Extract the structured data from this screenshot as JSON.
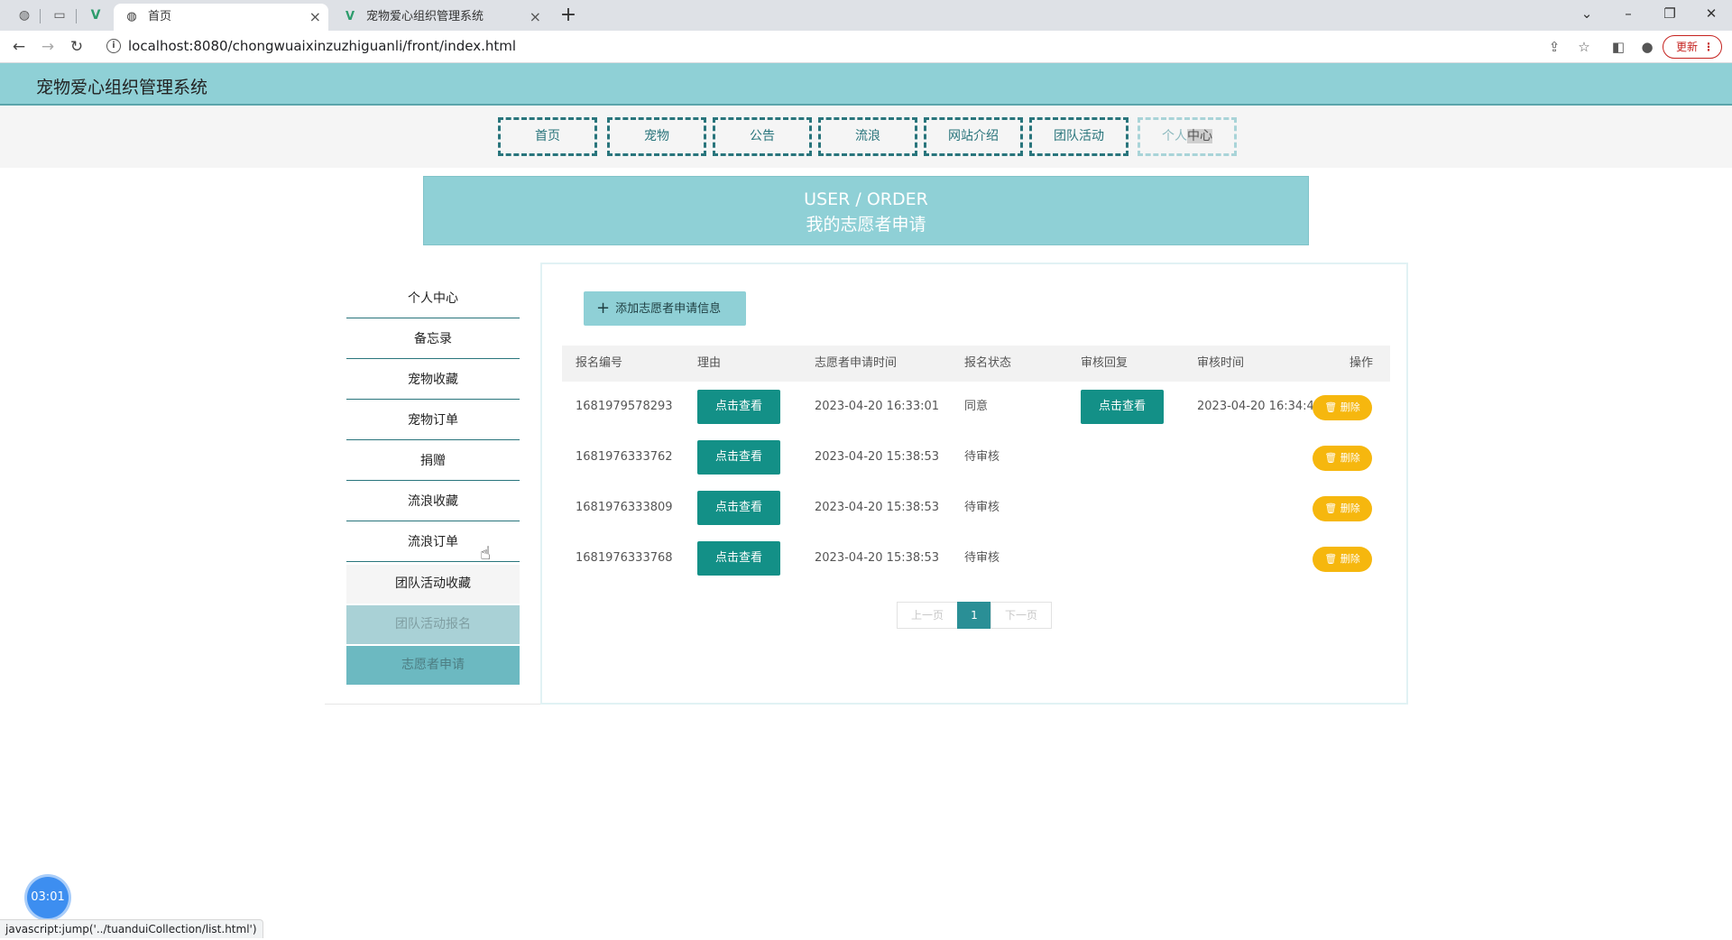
{
  "browser": {
    "tabs": [
      {
        "label": "首页",
        "favicon": "globe-icon"
      },
      {
        "label": "宠物爱心组织管理系统",
        "favicon": "vue-icon"
      }
    ],
    "address": "localhost:8080/chongwuaixinzuzhiguanli/front/index.html",
    "update_label": "更新",
    "status_url": "javascript:jump('../tuanduiCollection/list.html')"
  },
  "site": {
    "title": "宠物爱心组织管理系统"
  },
  "nav": [
    "首页",
    "宠物",
    "公告",
    "流浪",
    "网站介绍",
    "团队活动",
    "个人",
    "中心"
  ],
  "banner": {
    "en": "USER / ORDER",
    "cn": "我的志愿者申请"
  },
  "sidebar": [
    "个人中心",
    "备忘录",
    "宠物收藏",
    "宠物订单",
    "捐赠",
    "流浪收藏",
    "流浪订单",
    "团队活动收藏",
    "团队活动报名",
    "志愿者申请"
  ],
  "main": {
    "add_label": "添加志愿者申请信息",
    "columns": [
      "报名编号",
      "理由",
      "志愿者申请时间",
      "报名状态",
      "审核回复",
      "审核时间",
      "操作"
    ],
    "view_label": "点击查看",
    "delete_label": "删除",
    "rows": [
      {
        "id": "1681979578293",
        "time": "2023-04-20 16:33:01",
        "status": "同意",
        "has_reply": true,
        "review_time": "2023-04-20 16:34:46"
      },
      {
        "id": "1681976333762",
        "time": "2023-04-20 15:38:53",
        "status": "待审核",
        "has_reply": false,
        "review_time": ""
      },
      {
        "id": "1681976333809",
        "time": "2023-04-20 15:38:53",
        "status": "待审核",
        "has_reply": false,
        "review_time": ""
      },
      {
        "id": "1681976333768",
        "time": "2023-04-20 15:38:53",
        "status": "待审核",
        "has_reply": false,
        "review_time": ""
      }
    ],
    "pager": {
      "prev": "上一页",
      "current": "1",
      "next": "下一页"
    }
  },
  "timer": "03:01",
  "colors": {
    "header": "#8fd0d6",
    "nav_border": "#29757c",
    "view_button": "#139087",
    "delete_button": "#f6b70e",
    "active_sidebar": "#6cb9c1"
  }
}
